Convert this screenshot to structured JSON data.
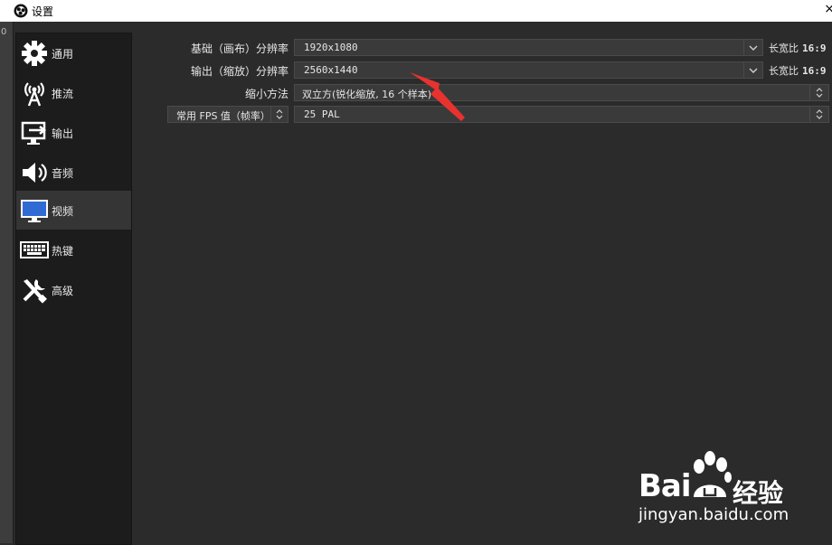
{
  "window": {
    "title": "设置",
    "close": "×"
  },
  "leftstrip": {
    "mark": "0"
  },
  "sidebar": {
    "items": [
      {
        "label": "通用",
        "icon": "gear-icon"
      },
      {
        "label": "推流",
        "icon": "broadcast-icon"
      },
      {
        "label": "输出",
        "icon": "output-icon"
      },
      {
        "label": "音频",
        "icon": "speaker-icon"
      },
      {
        "label": "视频",
        "icon": "monitor-icon",
        "selected": true
      },
      {
        "label": "热键",
        "icon": "keyboard-icon"
      },
      {
        "label": "高级",
        "icon": "tools-icon"
      }
    ]
  },
  "video": {
    "base_res": {
      "label": "基础（画布）分辨率",
      "value": "1920x1080",
      "aspect_label": "长宽比",
      "aspect": "16:9"
    },
    "output_res": {
      "label": "输出（缩放）分辨率",
      "value": "2560x1440",
      "aspect_label": "长宽比",
      "aspect": "16:9"
    },
    "downscale": {
      "label": "缩小方法",
      "value": "双立方(锐化缩放, 16 个样本)"
    },
    "fps": {
      "type_label": "常用 FPS 值（帧率）",
      "value": "25 PAL"
    }
  },
  "watermark": {
    "logo_text": "Bai",
    "logo_suffix": "经验",
    "url": "jingyan.baidu.com"
  },
  "colors": {
    "background": "#2b2b2b",
    "sidebar": "#1c1c1c",
    "field": "#3a3a3a",
    "arrow": "#e8322f"
  }
}
